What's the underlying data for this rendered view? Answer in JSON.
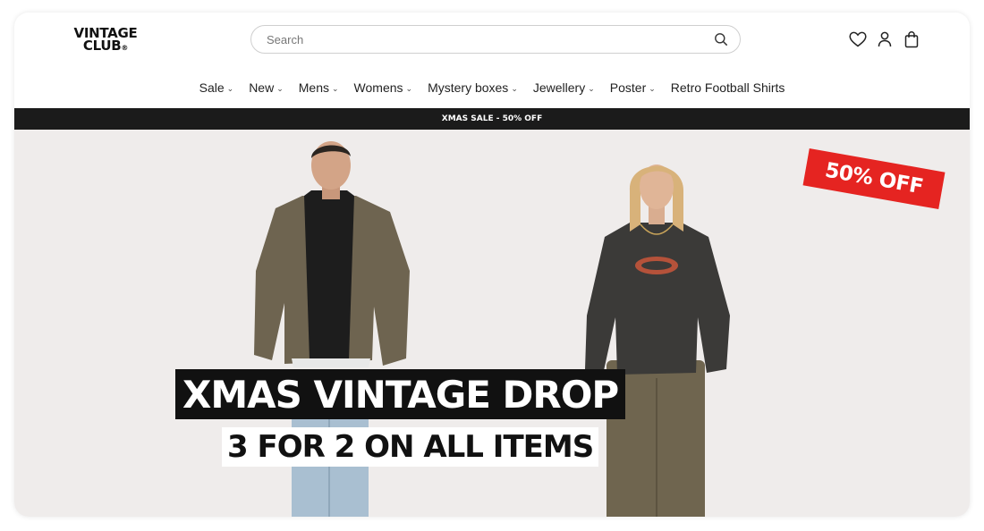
{
  "brand": {
    "logo_line1": "VINTAGE",
    "logo_line2": "CLUB",
    "logo_mark": "®"
  },
  "search": {
    "placeholder": "Search",
    "icon": "magnifier"
  },
  "header_icons": [
    "heart-icon",
    "account-icon",
    "bag-icon"
  ],
  "nav": {
    "items": [
      {
        "label": "Sale",
        "has_dropdown": true
      },
      {
        "label": "New",
        "has_dropdown": true
      },
      {
        "label": "Mens",
        "has_dropdown": true
      },
      {
        "label": "Womens",
        "has_dropdown": true
      },
      {
        "label": "Mystery boxes",
        "has_dropdown": true
      },
      {
        "label": "Jewellery",
        "has_dropdown": true
      },
      {
        "label": "Poster",
        "has_dropdown": true
      },
      {
        "label": "Retro Football Shirts",
        "has_dropdown": false
      }
    ],
    "chevron": "⌄"
  },
  "announcement": {
    "text": "XMAS SALE - 50% OFF",
    "bg_color": "#1b1b1b"
  },
  "hero": {
    "badge": "50% OFF",
    "headline": "XMAS VINTAGE DROP",
    "subline": "3 FOR 2 ON ALL ITEMS",
    "badge_color": "#e52421",
    "background_color": "#efeceb"
  }
}
